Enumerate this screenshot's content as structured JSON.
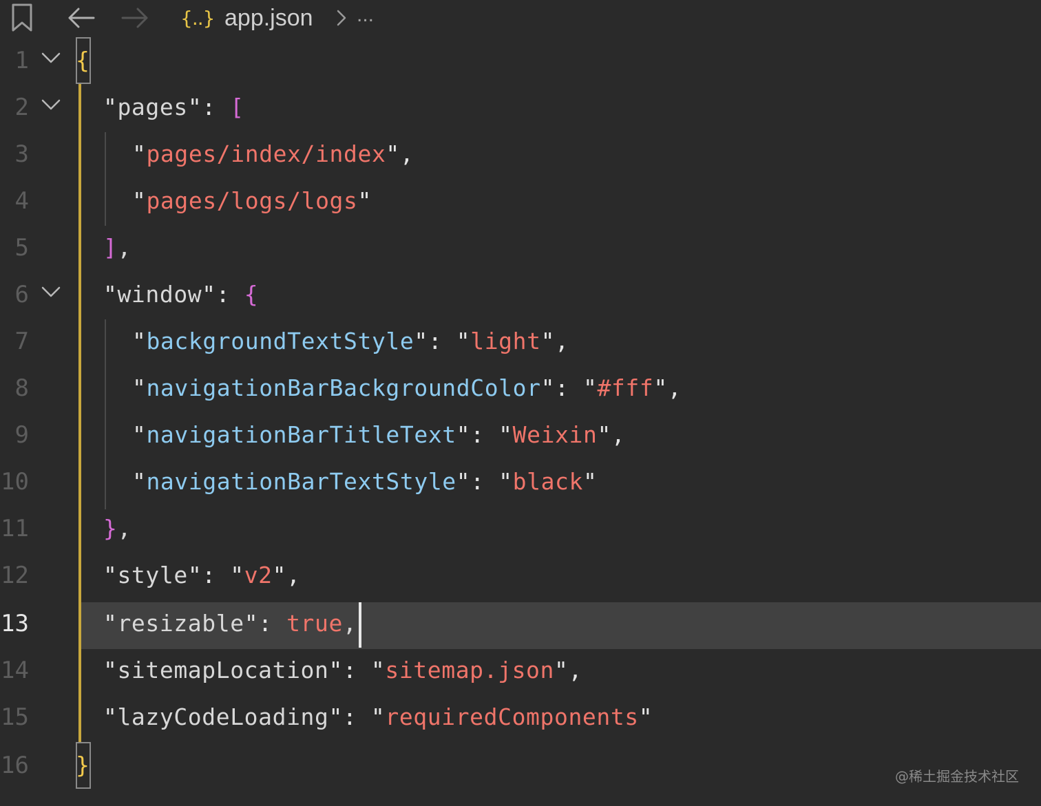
{
  "topbar": {
    "file_icon_glyph": "{..}",
    "filename": "app.json",
    "separator": ">",
    "ellipsis": "..."
  },
  "editor": {
    "current_line": 13,
    "lines": [
      {
        "n": "1"
      },
      {
        "n": "2"
      },
      {
        "n": "3"
      },
      {
        "n": "4"
      },
      {
        "n": "5"
      },
      {
        "n": "6"
      },
      {
        "n": "7"
      },
      {
        "n": "8"
      },
      {
        "n": "9"
      },
      {
        "n": "10"
      },
      {
        "n": "11"
      },
      {
        "n": "12"
      },
      {
        "n": "13"
      },
      {
        "n": "14"
      },
      {
        "n": "15"
      },
      {
        "n": "16"
      }
    ],
    "code": {
      "l1_open": "{",
      "l2_key": "pages",
      "l2_bracket": "[",
      "l3_val": "pages/index/index",
      "l4_val": "pages/logs/logs",
      "l5_close": "]",
      "l6_key": "window",
      "l6_brace": "{",
      "l7_key": "backgroundTextStyle",
      "l7_val": "light",
      "l8_key": "navigationBarBackgroundColor",
      "l8_val": "#fff",
      "l9_key": "navigationBarTitleText",
      "l9_val": "Weixin",
      "l10_key": "navigationBarTextStyle",
      "l10_val": "black",
      "l11_close": "}",
      "l12_key": "style",
      "l12_val": "v2",
      "l13_key": "resizable",
      "l13_val": "true",
      "l14_key": "sitemapLocation",
      "l14_val": "sitemap.json",
      "l15_key": "lazyCodeLoading",
      "l15_val": "requiredComponents",
      "l16_close": "}"
    }
  },
  "watermark": "@稀土掘金技术社区",
  "colors": {
    "background": "#2a2a2a",
    "current_line": "#414141",
    "string": "#f0756a",
    "key": "#8ecbf0",
    "bracket_purple": "#d66bd6",
    "brace_yellow": "#f2c94c"
  }
}
